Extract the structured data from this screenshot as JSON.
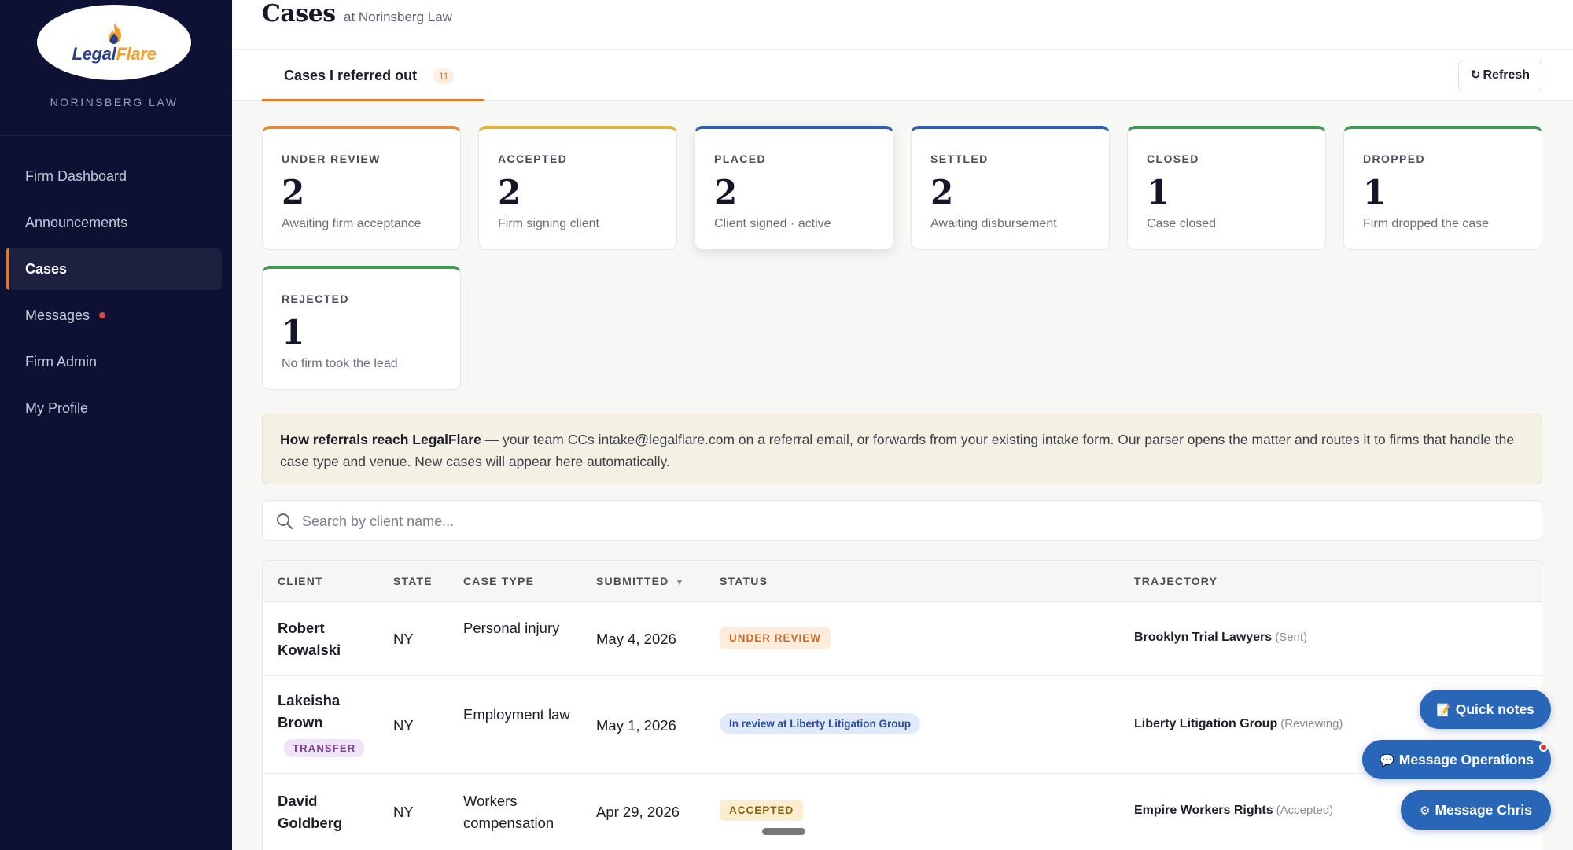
{
  "brand": {
    "logo_part1": "Legal",
    "logo_part2": "Flare",
    "firm_name": "NORINSBERG LAW"
  },
  "sidebar": {
    "items": [
      {
        "label": "Firm Dashboard"
      },
      {
        "label": "Announcements"
      },
      {
        "label": "Cases"
      },
      {
        "label": "Messages"
      },
      {
        "label": "Firm Admin"
      },
      {
        "label": "My Profile"
      }
    ]
  },
  "header": {
    "title": "Cases",
    "subtitle": "at Norinsberg Law",
    "tab_label": "Cases I referred out",
    "tab_count": "11",
    "refresh_label": "Refresh"
  },
  "stats": [
    {
      "label": "UNDER REVIEW",
      "value": "2",
      "desc": "Awaiting firm acceptance",
      "color": "#e08b3c"
    },
    {
      "label": "ACCEPTED",
      "value": "2",
      "desc": "Firm signing client",
      "color": "#e0b43c"
    },
    {
      "label": "PLACED",
      "value": "2",
      "desc": "Client signed · active",
      "color": "#2d5fb0"
    },
    {
      "label": "SETTLED",
      "value": "2",
      "desc": "Awaiting disbursement",
      "color": "#2d5fb0"
    },
    {
      "label": "CLOSED",
      "value": "1",
      "desc": "Case closed",
      "color": "#3c9a52"
    },
    {
      "label": "DROPPED",
      "value": "1",
      "desc": "Firm dropped the case",
      "color": "#3c9a52"
    },
    {
      "label": "REJECTED",
      "value": "1",
      "desc": "No firm took the lead",
      "color": "#3c9a52"
    }
  ],
  "banner": {
    "bold": "How referrals reach LegalFlare",
    "text": " — your team CCs intake@legalflare.com on a referral email, or forwards from your existing intake form. Our parser opens the matter and routes it to firms that handle the case type and venue. New cases will appear here automatically."
  },
  "search": {
    "placeholder": "Search by client name..."
  },
  "table": {
    "headers": {
      "client": "CLIENT",
      "state": "STATE",
      "case_type": "CASE TYPE",
      "submitted": "SUBMITTED",
      "status": "STATUS",
      "trajectory": "TRAJECTORY"
    },
    "rows": [
      {
        "client": "Robert Kowalski",
        "state": "NY",
        "case_type": "Personal injury",
        "submitted": "May 4, 2026",
        "status": "UNDER REVIEW",
        "tag": "",
        "traj_firm": "Brooklyn Trial Lawyers",
        "traj_status": "(Sent)"
      },
      {
        "client": "Lakeisha Brown",
        "state": "NY",
        "case_type": "Employment law",
        "submitted": "May 1, 2026",
        "status": "In review at Liberty Litigation Group",
        "tag": "TRANSFER",
        "traj_firm": "Liberty Litigation Group",
        "traj_status": "(Reviewing)"
      },
      {
        "client": "David Goldberg",
        "state": "NY",
        "case_type": "Workers compensation",
        "submitted": "Apr 29, 2026",
        "status": "ACCEPTED",
        "tag": "",
        "traj_firm": "Empire Workers Rights",
        "traj_status": "(Accepted)"
      }
    ]
  },
  "floating": {
    "quick_notes": "Quick notes",
    "message_ops": "Message Operations",
    "message_chris": "Message Chris"
  }
}
